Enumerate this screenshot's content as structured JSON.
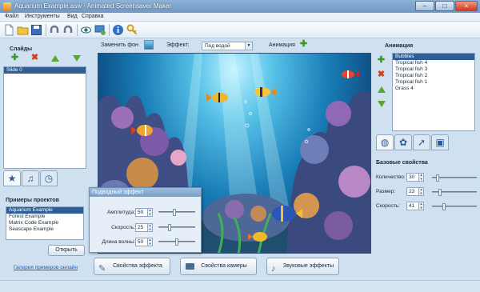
{
  "window": {
    "title": "Aquarium Example.asw - Animated Screensaver Maker",
    "minimize": "–",
    "maximize": "□",
    "close": "×"
  },
  "menu": [
    "Файл",
    "Инструменты",
    "Вид",
    "Справка"
  ],
  "toolbar_icons": [
    "new-icon",
    "open-folder-icon",
    "save-icon",
    "undo-icon",
    "redo-icon",
    "preview-eye-icon",
    "screen-settings-icon",
    "info-icon",
    "key-icon"
  ],
  "scene_toolbar": {
    "replace_bg_label": "Заменить фон",
    "effect_label": "Эффект:",
    "effect_selected": "Под водой",
    "animation_label": "Анимация"
  },
  "slides": {
    "title": "Слайды",
    "items": [
      "Slide 0"
    ]
  },
  "left_tabs": [
    "star-icon",
    "music-note-icon",
    "clock-icon"
  ],
  "examples": {
    "title": "Примеры проектов",
    "items": [
      "Aquarium Example",
      "Forest Example",
      "Matrix Code Example",
      "Seascape Example"
    ],
    "open_button": "Открыть",
    "gallery_link": "Галерея примеров онлайн"
  },
  "effect_dialog": {
    "title": "Подводный эффект",
    "rows": [
      {
        "label": "Амплитуда:",
        "value": "50",
        "level": 0.45
      },
      {
        "label": "Скорость:",
        "value": "25",
        "level": 0.3
      },
      {
        "label": "Длина волны:",
        "value": "50",
        "level": 0.5
      }
    ]
  },
  "bottom_buttons": {
    "effect_props": "Свойства эффекта",
    "camera_props": "Свойства камеры",
    "sound_effects": "Звуковые эффекты"
  },
  "animation": {
    "title": "Анимация",
    "items": [
      "Bubbles",
      "Tropical fish 4",
      "Tropical fish 3",
      "Tropical fish 2",
      "Tropical fish 1",
      "Grass 4"
    ]
  },
  "right_tabs": [
    "object-props-icon",
    "palette-icon",
    "motion-icon",
    "frame-icon"
  ],
  "base_props": {
    "title": "Базовые свойства",
    "rows": [
      {
        "label": "Количество:",
        "value": "30",
        "level": 0.1
      },
      {
        "label": "Размер:",
        "value": "23",
        "level": 0.15
      },
      {
        "label": "Скорость:",
        "value": "41",
        "level": 0.25
      }
    ]
  },
  "colors": {
    "accent": "#2e5e94",
    "window_bg": "#cfe0f0",
    "water_deep": "#062a52"
  }
}
